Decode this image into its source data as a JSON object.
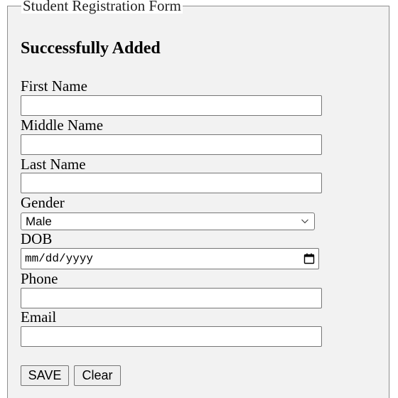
{
  "form": {
    "legend": "Student Registration Form",
    "status_message": "Successfully Added",
    "fields": {
      "first_name": {
        "label": "First Name",
        "value": ""
      },
      "middle_name": {
        "label": "Middle Name",
        "value": ""
      },
      "last_name": {
        "label": "Last Name",
        "value": ""
      },
      "gender": {
        "label": "Gender",
        "selected": "Male",
        "icon": "chevron-down-icon"
      },
      "dob": {
        "label": "DOB",
        "placeholder": "mm/dd/yyyy",
        "icon": "calendar-icon"
      },
      "phone": {
        "label": "Phone",
        "value": ""
      },
      "email": {
        "label": "Email",
        "value": ""
      }
    },
    "buttons": {
      "save": "SAVE",
      "clear": "Clear"
    }
  },
  "colors": {
    "form_background": "#f2f2f2",
    "border": "#767676",
    "button_background": "#efefef"
  }
}
